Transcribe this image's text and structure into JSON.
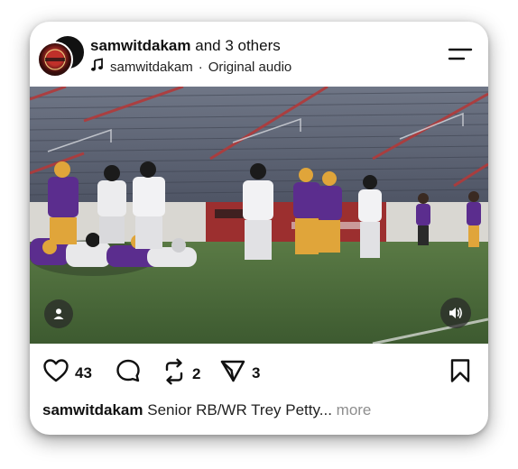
{
  "post": {
    "author": "samwitdakam",
    "coauthors_text": "and 3 others",
    "audio_user": "samwitdakam",
    "audio_separator": "·",
    "audio_label": "Original audio"
  },
  "engagement": {
    "likes": "43",
    "reposts": "2",
    "shares": "3"
  },
  "caption": {
    "username": "samwitdakam",
    "text": "Senior RB/WR Trey Petty...",
    "more_label": "more"
  },
  "icons": {
    "menu": "menu-lines-icon",
    "audio": "music-note-icon",
    "like": "heart-icon",
    "comment": "comment-bubble-icon",
    "repost": "repost-icon",
    "share": "paper-plane-icon",
    "save": "bookmark-icon",
    "user_tag": "person-icon",
    "volume": "speaker-icon"
  },
  "colors": {
    "stadium_seats": "#5b6170",
    "stadium_rail": "#b23a3a",
    "turf": "#4a6a3a",
    "team_purple": "#5b2d8e",
    "team_gold": "#e0a53a"
  }
}
